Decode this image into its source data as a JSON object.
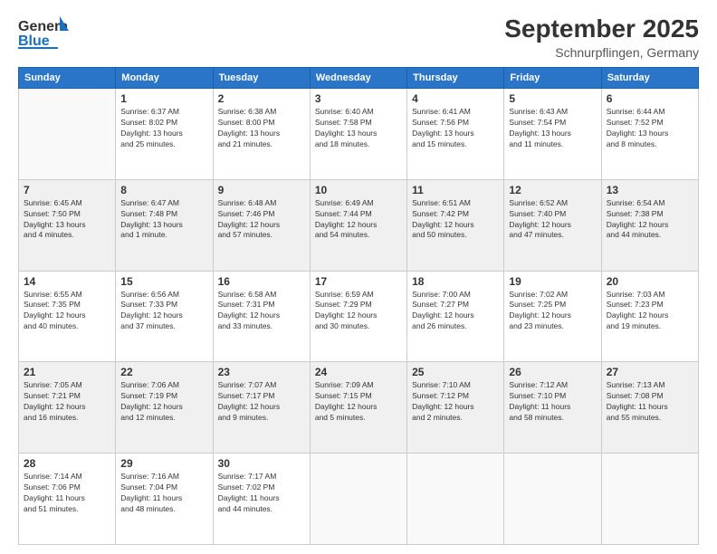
{
  "header": {
    "logo": {
      "general": "General",
      "blue": "Blue"
    },
    "title": "September 2025",
    "subtitle": "Schnurpflingen, Germany"
  },
  "calendar": {
    "headers": [
      "Sunday",
      "Monday",
      "Tuesday",
      "Wednesday",
      "Thursday",
      "Friday",
      "Saturday"
    ],
    "rows": [
      [
        {
          "day": "",
          "info": ""
        },
        {
          "day": "1",
          "info": "Sunrise: 6:37 AM\nSunset: 8:02 PM\nDaylight: 13 hours\nand 25 minutes."
        },
        {
          "day": "2",
          "info": "Sunrise: 6:38 AM\nSunset: 8:00 PM\nDaylight: 13 hours\nand 21 minutes."
        },
        {
          "day": "3",
          "info": "Sunrise: 6:40 AM\nSunset: 7:58 PM\nDaylight: 13 hours\nand 18 minutes."
        },
        {
          "day": "4",
          "info": "Sunrise: 6:41 AM\nSunset: 7:56 PM\nDaylight: 13 hours\nand 15 minutes."
        },
        {
          "day": "5",
          "info": "Sunrise: 6:43 AM\nSunset: 7:54 PM\nDaylight: 13 hours\nand 11 minutes."
        },
        {
          "day": "6",
          "info": "Sunrise: 6:44 AM\nSunset: 7:52 PM\nDaylight: 13 hours\nand 8 minutes."
        }
      ],
      [
        {
          "day": "7",
          "info": "Sunrise: 6:45 AM\nSunset: 7:50 PM\nDaylight: 13 hours\nand 4 minutes."
        },
        {
          "day": "8",
          "info": "Sunrise: 6:47 AM\nSunset: 7:48 PM\nDaylight: 13 hours\nand 1 minute."
        },
        {
          "day": "9",
          "info": "Sunrise: 6:48 AM\nSunset: 7:46 PM\nDaylight: 12 hours\nand 57 minutes."
        },
        {
          "day": "10",
          "info": "Sunrise: 6:49 AM\nSunset: 7:44 PM\nDaylight: 12 hours\nand 54 minutes."
        },
        {
          "day": "11",
          "info": "Sunrise: 6:51 AM\nSunset: 7:42 PM\nDaylight: 12 hours\nand 50 minutes."
        },
        {
          "day": "12",
          "info": "Sunrise: 6:52 AM\nSunset: 7:40 PM\nDaylight: 12 hours\nand 47 minutes."
        },
        {
          "day": "13",
          "info": "Sunrise: 6:54 AM\nSunset: 7:38 PM\nDaylight: 12 hours\nand 44 minutes."
        }
      ],
      [
        {
          "day": "14",
          "info": "Sunrise: 6:55 AM\nSunset: 7:35 PM\nDaylight: 12 hours\nand 40 minutes."
        },
        {
          "day": "15",
          "info": "Sunrise: 6:56 AM\nSunset: 7:33 PM\nDaylight: 12 hours\nand 37 minutes."
        },
        {
          "day": "16",
          "info": "Sunrise: 6:58 AM\nSunset: 7:31 PM\nDaylight: 12 hours\nand 33 minutes."
        },
        {
          "day": "17",
          "info": "Sunrise: 6:59 AM\nSunset: 7:29 PM\nDaylight: 12 hours\nand 30 minutes."
        },
        {
          "day": "18",
          "info": "Sunrise: 7:00 AM\nSunset: 7:27 PM\nDaylight: 12 hours\nand 26 minutes."
        },
        {
          "day": "19",
          "info": "Sunrise: 7:02 AM\nSunset: 7:25 PM\nDaylight: 12 hours\nand 23 minutes."
        },
        {
          "day": "20",
          "info": "Sunrise: 7:03 AM\nSunset: 7:23 PM\nDaylight: 12 hours\nand 19 minutes."
        }
      ],
      [
        {
          "day": "21",
          "info": "Sunrise: 7:05 AM\nSunset: 7:21 PM\nDaylight: 12 hours\nand 16 minutes."
        },
        {
          "day": "22",
          "info": "Sunrise: 7:06 AM\nSunset: 7:19 PM\nDaylight: 12 hours\nand 12 minutes."
        },
        {
          "day": "23",
          "info": "Sunrise: 7:07 AM\nSunset: 7:17 PM\nDaylight: 12 hours\nand 9 minutes."
        },
        {
          "day": "24",
          "info": "Sunrise: 7:09 AM\nSunset: 7:15 PM\nDaylight: 12 hours\nand 5 minutes."
        },
        {
          "day": "25",
          "info": "Sunrise: 7:10 AM\nSunset: 7:12 PM\nDaylight: 12 hours\nand 2 minutes."
        },
        {
          "day": "26",
          "info": "Sunrise: 7:12 AM\nSunset: 7:10 PM\nDaylight: 11 hours\nand 58 minutes."
        },
        {
          "day": "27",
          "info": "Sunrise: 7:13 AM\nSunset: 7:08 PM\nDaylight: 11 hours\nand 55 minutes."
        }
      ],
      [
        {
          "day": "28",
          "info": "Sunrise: 7:14 AM\nSunset: 7:06 PM\nDaylight: 11 hours\nand 51 minutes."
        },
        {
          "day": "29",
          "info": "Sunrise: 7:16 AM\nSunset: 7:04 PM\nDaylight: 11 hours\nand 48 minutes."
        },
        {
          "day": "30",
          "info": "Sunrise: 7:17 AM\nSunset: 7:02 PM\nDaylight: 11 hours\nand 44 minutes."
        },
        {
          "day": "",
          "info": ""
        },
        {
          "day": "",
          "info": ""
        },
        {
          "day": "",
          "info": ""
        },
        {
          "day": "",
          "info": ""
        }
      ]
    ]
  }
}
